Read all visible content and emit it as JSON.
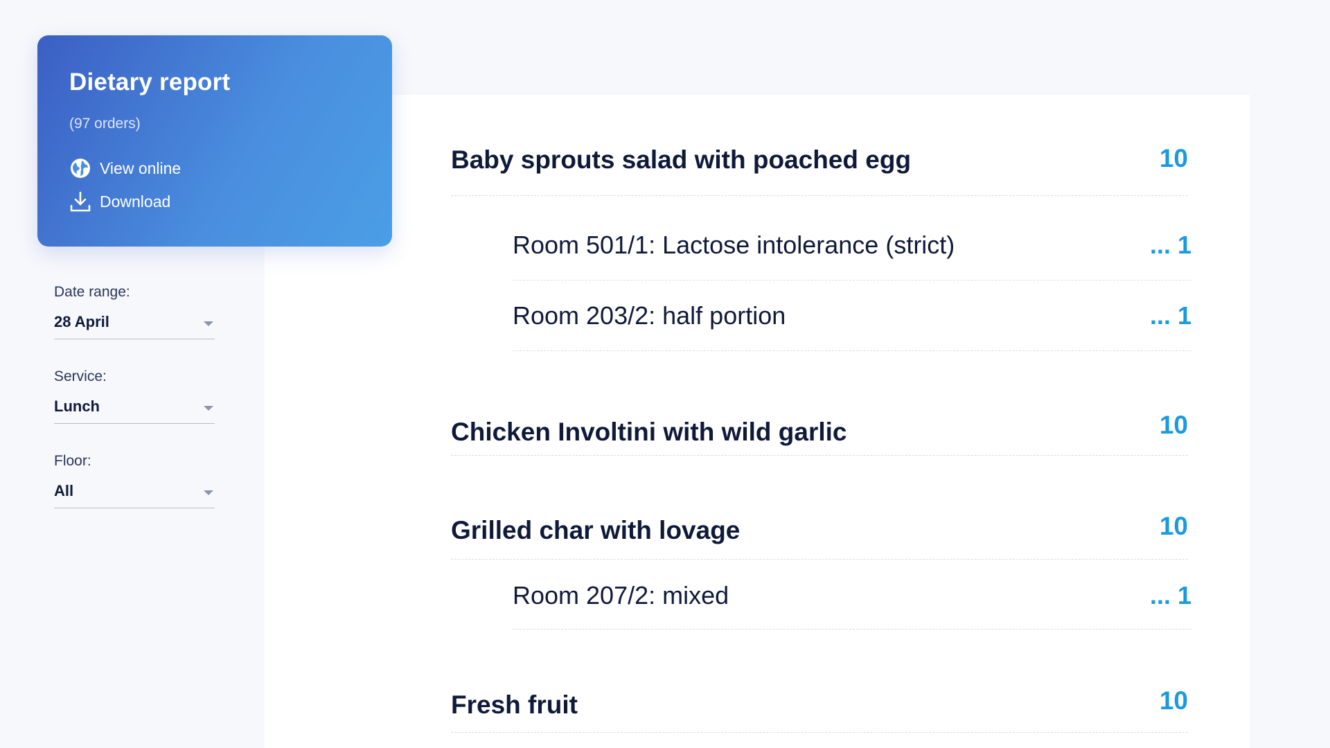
{
  "report": {
    "title": "Dietary report",
    "order_count": "(97 orders)",
    "view_online_label": "View online",
    "download_label": "Download"
  },
  "filters": [
    {
      "label": "Date range:",
      "value": "28 April"
    },
    {
      "label": "Service:",
      "value": "Lunch"
    },
    {
      "label": "Floor:",
      "value": "All"
    }
  ],
  "dishes": [
    {
      "name": "Baby sprouts salad with poached egg",
      "count": "10",
      "notes": [
        {
          "text": "Room 501/1: Lactose intolerance (strict)",
          "count": "... 1"
        },
        {
          "text": "Room 203/2: half portion",
          "count": "... 1"
        }
      ]
    },
    {
      "name": "Chicken Involtini with wild garlic",
      "count": "10",
      "notes": []
    },
    {
      "name": "Grilled char with lovage",
      "count": "10",
      "notes": [
        {
          "text": "Room 207/2: mixed",
          "count": "... 1"
        }
      ]
    },
    {
      "name": "Fresh fruit",
      "count": "10",
      "notes": []
    }
  ],
  "colors": {
    "accent": "#1b9ae0",
    "card_gradient_start": "#3b5fc4",
    "card_gradient_end": "#4a9ee6",
    "text": "#0f1a3a"
  },
  "icons": {
    "view_online": "globe-icon",
    "download": "download-icon",
    "select": "chevron-down-icon"
  }
}
